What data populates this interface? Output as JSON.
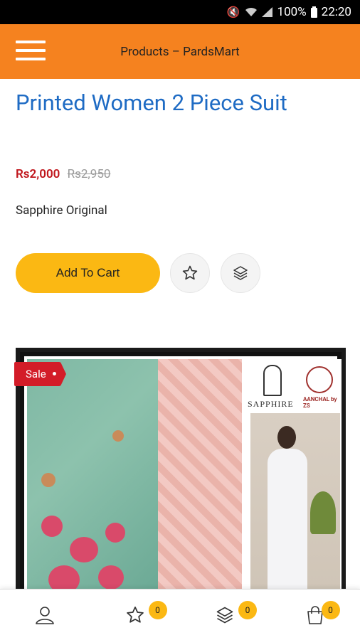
{
  "status_bar": {
    "battery": "100%",
    "time": "22:20"
  },
  "app_bar": {
    "title": "Products – PardsMart"
  },
  "product": {
    "title": "Printed Women 2 Piece Suit",
    "price": "Rs2,000",
    "old_price": "Rs2,950",
    "brand": "Sapphire Original",
    "add_to_cart_label": "Add To Cart",
    "sale_label": "Sale",
    "image_brand_text": "SAPPHIRE",
    "image_tag_text": "AANCHAL by ZS"
  },
  "bottom_nav": {
    "wishlist_count": "0",
    "compare_count": "0",
    "cart_count": "0"
  },
  "colors": {
    "app_bar": "#f5821f",
    "title_blue": "#1e6bc4",
    "price_red": "#c0161c",
    "button_yellow": "#fbb813",
    "sale_red": "#d31c28"
  },
  "icons": [
    "wifi-icon",
    "signal-icon",
    "battery-icon",
    "mute-icon",
    "menu-icon",
    "star-icon",
    "layers-icon",
    "user-icon",
    "bag-icon"
  ]
}
